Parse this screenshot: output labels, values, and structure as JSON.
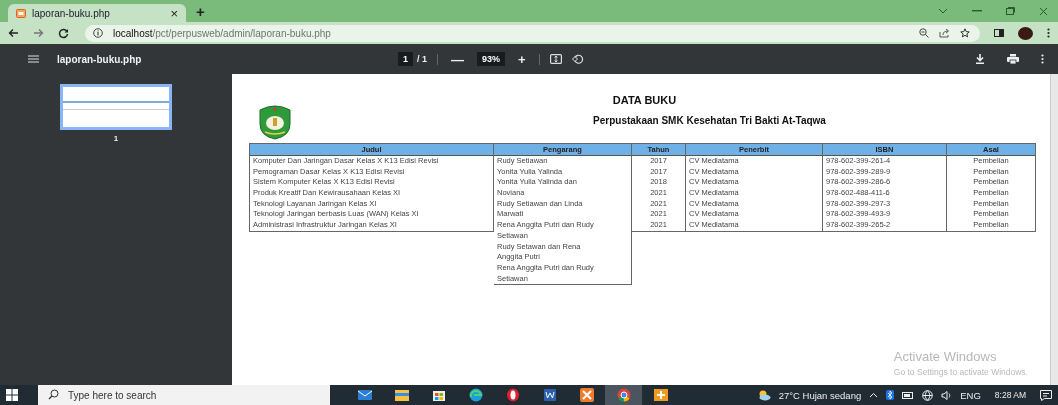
{
  "browser": {
    "tab": {
      "title": "laporan-buku.php",
      "close": "×"
    },
    "new_tab": "+",
    "url_host": "localhost",
    "url_path": "/pct/perpusweb/admin/laporan-buku.php"
  },
  "pdf_toolbar": {
    "title": "laporan-buku.php",
    "page": "1",
    "page_total": "/ 1",
    "zoom_out": "—",
    "zoom": "93%",
    "zoom_in": "+"
  },
  "sidebar": {
    "thumbnails": [
      {
        "label": "1",
        "selected": true
      }
    ]
  },
  "document": {
    "title": "DATA BUKU",
    "subtitle": "Perpustakaan SMK Kesehatan Tri Bakti At-Taqwa",
    "table": {
      "columns": [
        "Judul",
        "Pengarang",
        "Tahun",
        "Penerbit",
        "ISBN",
        "Asal"
      ],
      "rows": [
        [
          "Komputer Dan Jaringan Dasar Kelas X K13 Edisi Revisi",
          "Rudy Setiawan",
          "2017",
          "CV Mediatama",
          "978-602-399-261-4",
          "Pembelian"
        ],
        [
          "Pemograman Dasar Kelas X K13 Edisi Revisi",
          "Yonita Yulia Yalinda",
          "2017",
          "CV Mediatama",
          "978-602-399-289-9",
          "Pembelian"
        ],
        [
          "Sistem Komputer Kelas X K13 Edisi Revisi",
          "Yonita Yulia Yalinda dan",
          "2018",
          "CV Mediatama",
          "978-602-399-286-6",
          "Pembelian"
        ],
        [
          "Produk Kreatif Dan Kewirausahaan Kelas XI",
          "Noviana",
          "2021",
          "CV Mediatama",
          "978-602-488-411-6",
          "Pembelian"
        ],
        [
          "Teknologi Layanan Jaringan  Kelas XI",
          "Rudy Setiawan dan Linda",
          "2021",
          "CV Mediatama",
          "978-602-399-297-3",
          "Pembelian"
        ],
        [
          "Teknologi Jaringan berbasis Luas (WAN) Kelas XI",
          "Marwati",
          "2021",
          "CV Mediatama",
          "978-602-399-493-9",
          "Pembelian"
        ],
        [
          "Administrasi Infrastruktur Jaringan Kelas XI",
          "Rena Anggita Putri dan Rudy",
          "2021",
          "CV Mediatama",
          "978-602-399-265-2",
          "Pembelian"
        ],
        [
          null,
          "Setiawan"
        ],
        [
          null,
          "Rudy Setawan dan Rena"
        ],
        [
          null,
          "Anggita Putri"
        ],
        [
          null,
          "Rena Anggita Putri dan Rudy"
        ],
        [
          null,
          "Setiawan"
        ]
      ]
    }
  },
  "activation_notice": {
    "title": "Activate Windows",
    "text": "Go to Settings to activate Windows."
  },
  "taskbar": {
    "search": {
      "placeholder": "Type here to search"
    },
    "weather": "27°C  Hujan sedang",
    "language": "ENG",
    "time": "8:28 AM"
  }
}
